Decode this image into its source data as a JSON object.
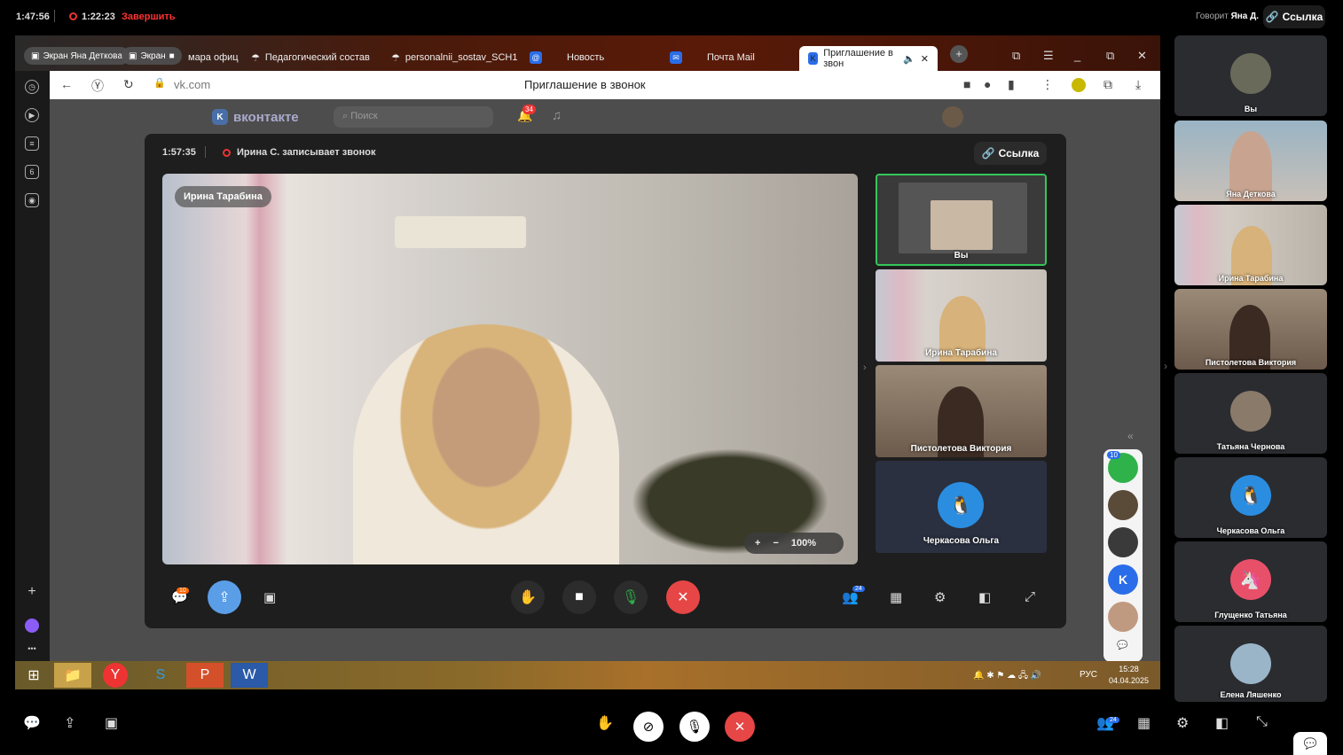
{
  "top": {
    "call_time": "1:47:56",
    "record_time": "1:22:23",
    "end_label": "Завершить",
    "speaker_prefix": "Говорит",
    "speaker_name": "Яна Д.",
    "link_label": "Ссылка"
  },
  "browser": {
    "overlay_share1": "Экран Яна Детковa",
    "overlay_share2": "Экран",
    "tabs": [
      {
        "label": "мара офиц"
      },
      {
        "label": "Педагогический состав"
      },
      {
        "label": "personalnii_sostav_SCH1"
      },
      {
        "label": "Новость"
      },
      {
        "label": "Почта Mail"
      },
      {
        "label": "Приглашение в звон"
      }
    ],
    "url": "vk.com",
    "page_title": "Приглашение в звонок",
    "vk_logo": "вконтакте",
    "vk_search_placeholder": "Поиск",
    "vk_notif_count": "34",
    "sidebar_badge": "6"
  },
  "call": {
    "time": "1:57:35",
    "recording_text": "Ирина С. записывает звонок",
    "link_label": "Ссылка",
    "main_name": "Ирина Тарабина",
    "zoom_level": "100%",
    "zoom_plus": "+",
    "zoom_minus": "−",
    "thumbs": [
      {
        "name": "Вы"
      },
      {
        "name": "Ирина Тарабина"
      },
      {
        "name": "Пистолетова Виктория"
      },
      {
        "name": "Черкасова Ольга"
      }
    ],
    "chat_badge": "10",
    "participants_count": "24"
  },
  "taskbar": {
    "lang": "РУС",
    "time": "15:28",
    "date": "04.04.2025"
  },
  "strip": {
    "badge": "10"
  },
  "participants": [
    {
      "name": "Вы"
    },
    {
      "name": "Яна Деткова"
    },
    {
      "name": "Ирина Тарабина"
    },
    {
      "name": "Пистолетова Виктория"
    },
    {
      "name": "Татьяна Чернова"
    },
    {
      "name": "Черкасова Ольга"
    },
    {
      "name": "Глущенко Татьяна"
    },
    {
      "name": "Елена Ляшенко"
    }
  ],
  "bottom": {
    "participants_count": "24"
  },
  "colors": {
    "end_call": "#e64646",
    "mic_green": "#2fb24a",
    "share_blue": "#5b9ee8",
    "record_red": "#e33333",
    "active_border": "#34c759"
  }
}
